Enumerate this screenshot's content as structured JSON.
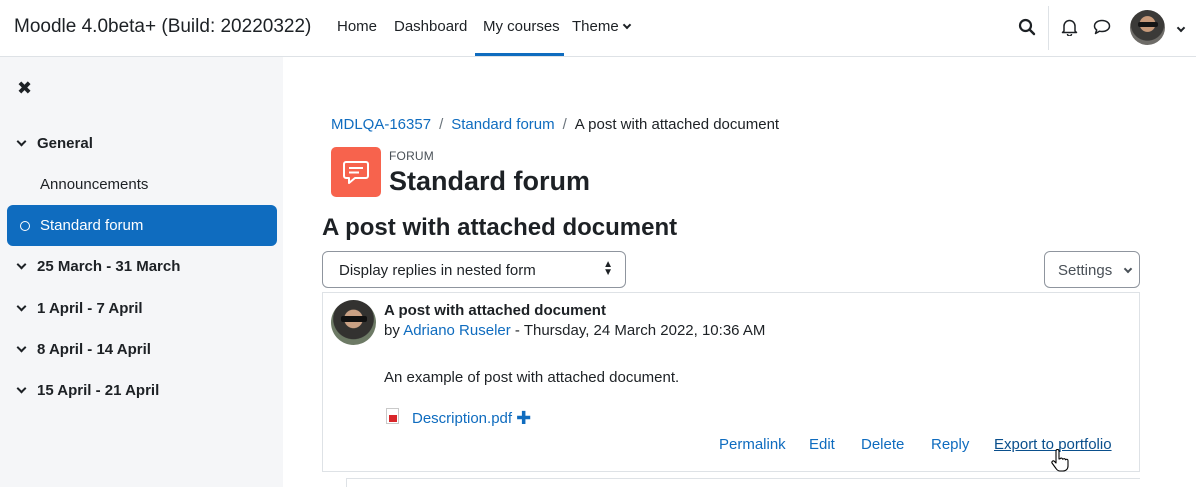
{
  "navbar": {
    "site_name": "Moodle 4.0beta+ (Build: 20220322)",
    "items": [
      "Home",
      "Dashboard",
      "My courses",
      "Theme"
    ],
    "active": "My courses",
    "icons": [
      "search-icon",
      "bell-icon",
      "chat-icon",
      "avatar",
      "chevron-down-icon"
    ]
  },
  "sidebar": {
    "close_icon": "close-icon",
    "sections": [
      {
        "label": "General",
        "items": [
          "Announcements",
          "Standard forum"
        ]
      },
      {
        "label": "25 March - 31 March"
      },
      {
        "label": "1 April - 7 April"
      },
      {
        "label": "8 April - 14 April"
      },
      {
        "label": "15 April - 21 April"
      }
    ],
    "active_item": "Standard forum"
  },
  "breadcrumb": [
    "MDLQA-16357",
    "Standard forum",
    "A post with attached document"
  ],
  "forum": {
    "kicker": "FORUM",
    "title": "Standard forum",
    "icon_color": "#f7634d"
  },
  "discussion": {
    "title": "A post with attached document",
    "display_mode": "Display replies in nested form",
    "settings_label": "Settings"
  },
  "post": {
    "subject": "A post with attached document",
    "by_prefix": "by",
    "author": "Adriano Ruseler",
    "date": "- Thursday, 24 March 2022, 10:36 AM",
    "body": "An example of post with attached document.",
    "attachment": "Description.pdf",
    "actions": [
      "Permalink",
      "Edit",
      "Delete",
      "Reply",
      "Export to portfolio"
    ]
  },
  "colors": {
    "primary": "#0f6cbf",
    "sidebar_bg": "#f5f6f8"
  }
}
